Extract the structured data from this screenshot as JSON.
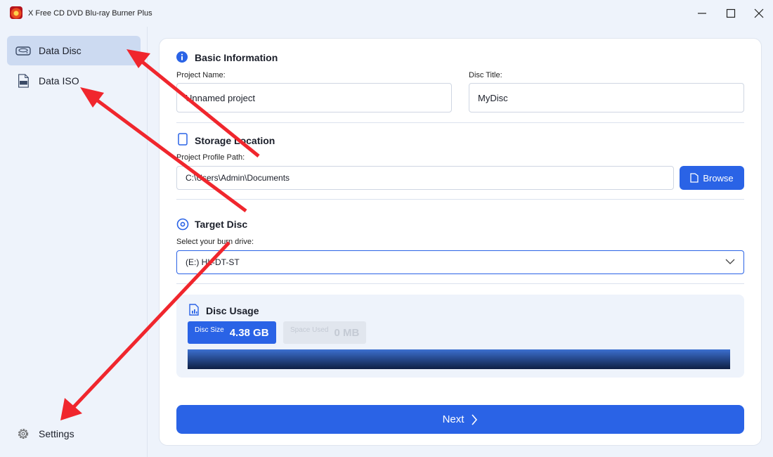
{
  "window": {
    "title": "X Free CD DVD Blu-ray Burner Plus"
  },
  "sidebar": {
    "items": [
      {
        "label": "Data Disc",
        "icon": "drive-icon",
        "active": true
      },
      {
        "label": "Data ISO",
        "icon": "iso-file-icon",
        "active": false
      }
    ],
    "settings_label": "Settings"
  },
  "basic_info": {
    "title": "Basic Information",
    "project_name_label": "Project Name:",
    "project_name_value": "Unnamed project",
    "disc_title_label": "Disc Title:",
    "disc_title_value": "MyDisc"
  },
  "storage": {
    "title": "Storage Location",
    "path_label": "Project Profile Path:",
    "path_value": "C:\\Users\\Admin\\Documents",
    "browse_label": "Browse"
  },
  "target": {
    "title": "Target Disc",
    "drive_label": "Select your burn drive:",
    "drive_selected": "(E:) HL-DT-ST"
  },
  "usage": {
    "title": "Disc Usage",
    "disc_size_label": "Disc Size",
    "disc_size_value": "4.38 GB",
    "space_used_label": "Space Used",
    "space_used_value": "0 MB"
  },
  "next_label": "Next",
  "colors": {
    "accent": "#2a63e6",
    "sidebar_active": "#ccdaf1",
    "background": "#eef3fb",
    "annotation": "#f0262d"
  }
}
